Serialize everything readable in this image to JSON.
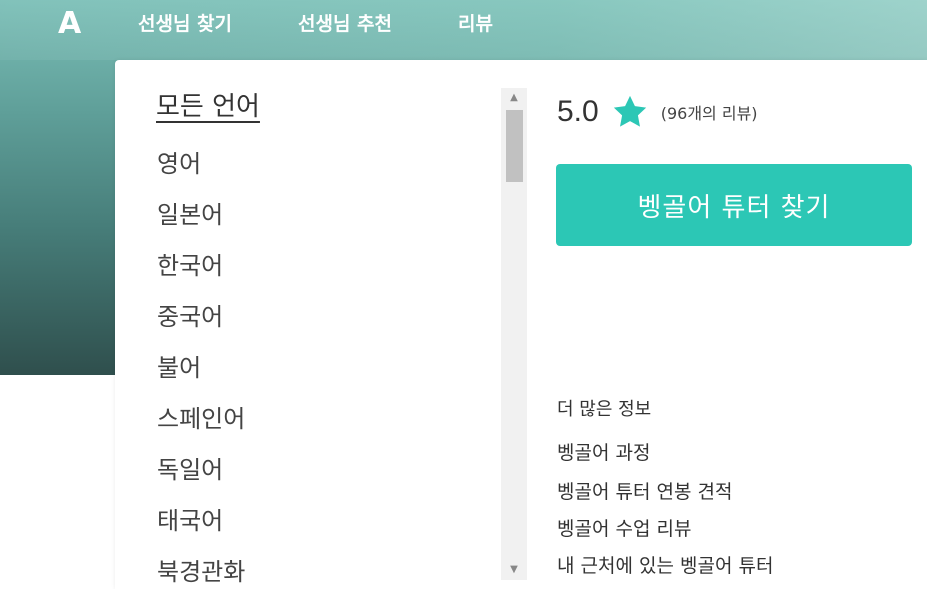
{
  "nav": {
    "logo": "A",
    "links": [
      "선생님 찾기",
      "선생님 추천",
      "리뷰"
    ]
  },
  "languages": {
    "all": "모든 언어",
    "items": [
      "영어",
      "일본어",
      "한국어",
      "중국어",
      "불어",
      "스페인어",
      "독일어",
      "태국어",
      "북경관화"
    ]
  },
  "rating": {
    "value": "5.0",
    "count": "(96개의 리뷰)",
    "star_icon": "star-icon",
    "star_color": "#2cc7b5"
  },
  "cta": {
    "label": "벵골어 튜터 찾기",
    "color": "#2cc7b5"
  },
  "more_info": {
    "title": "더 많은 정보",
    "links": [
      "벵골어 과정",
      "벵골어 튜터 연봉 견적",
      "벵골어 수업 리뷰",
      "내 근처에 있는 벵골어 튜터"
    ]
  }
}
